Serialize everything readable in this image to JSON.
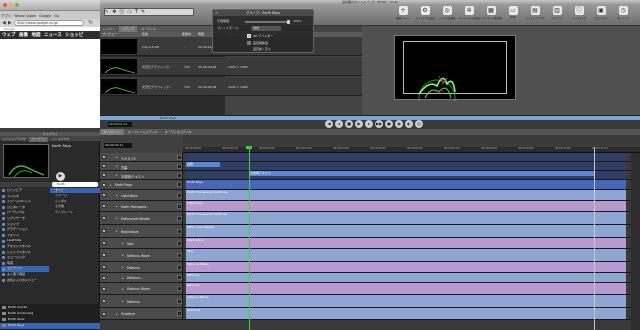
{
  "browser": {
    "tabs": [
      "アプリ",
      "Yahoo! Japan",
      "Google",
      "Go"
    ],
    "url": "http://www.google.co.jp/",
    "small_text": "Google",
    "nav": [
      "ウェブ",
      "画像",
      "地図",
      "ニュース",
      "ショッピ"
    ]
  },
  "fcp": {
    "title": "最初期のタイトルバック（NTSC）.motn",
    "toolbar": [
      {
        "label": "新規レイヤー",
        "icon": "+"
      },
      {
        "label": "ビヘイビアを追加",
        "icon": "⚙"
      },
      {
        "label": "フィルタを適用",
        "icon": "◎"
      },
      {
        "label": "パーティクルを作成",
        "icon": "✲"
      },
      {
        "label": "リプリケータを作成",
        "icon": "▦"
      },
      {
        "label": "HUD",
        "icon": "▭"
      },
      {
        "label": "ファイルブラウザ",
        "icon": "▤"
      },
      {
        "label": "ライブラリ",
        "icon": "▥"
      },
      {
        "label": "インスペクタ",
        "icon": "ⓘ"
      },
      {
        "label": "プロジェクト",
        "icon": "▣"
      },
      {
        "label": "タイミング",
        "icon": "◷"
      }
    ],
    "panel_tabs": [
      "レイヤー",
      "メディア",
      "オーディオ"
    ],
    "panel_columns": [
      "プレビュー",
      "名前",
      "使用中",
      "時間",
      "フレームサイズ",
      "アスペクト"
    ],
    "clips": [
      {
        "name": "Clip 4-5.aiff",
        "time": "00:00:02;11",
        "size": "",
        "flag": "-"
      },
      {
        "name": "光沢元グラフィック…",
        "time": "00:00:09;28",
        "size": "1920 × 1080",
        "flag": "YUV"
      },
      {
        "name": "光沢元グラフィック…",
        "time": "00:00:09;28",
        "size": "1920 × 1080",
        "flag": "YUV"
      }
    ],
    "hud": {
      "title": "グループ：Earth Rays",
      "opacity_label": "不透明度：",
      "opacity_value": "100%",
      "blend_label": "ブレンドモード：",
      "blend_value": "通常",
      "threed_label": "3D デバイダー",
      "scale_label": "固定解像度",
      "wh_label": "固定幅 / 高さ"
    },
    "strip": {
      "label": "Earth Rays",
      "timecode": "00:00:01;11"
    },
    "transport": [
      "◀",
      "◂",
      "■",
      "▶",
      "▸",
      "▶▶",
      "●",
      "◉",
      "◐",
      "◎"
    ],
    "timeline": {
      "tabs": [
        "タイムライン",
        "キーフレームエディタ",
        "オーディオエディタ"
      ],
      "timecode": "00:00:01;11",
      "ruler_ticks": [
        "00:00:00;00",
        "00:00:01;00",
        "00:00:02;00",
        "00:00:03;00",
        "00:00:04;00",
        "00:00:05;00",
        "00:00:06;00",
        "00:00:07;00",
        "00:00:08;00",
        "00:00:09;00",
        "00:00:10;00",
        "00:00:11;00"
      ],
      "layers": [
        {
          "name": "テキストE",
          "indent": 1,
          "bar": "",
          "bar_color": "#2f3e62"
        },
        {
          "name": "白幕",
          "indent": 1,
          "bar": "",
          "bar_color": "#2f3e62"
        },
        {
          "name": "半透明/テキスト",
          "indent": 1,
          "bar": "",
          "bar_color": "#2f3e62"
        },
        {
          "name": "Earth Rays",
          "indent": 0,
          "bar": "Earth Rays",
          "bar_color": "#4a66b8"
        },
        {
          "name": "Light Rays",
          "indent": 1,
          "bar": "Earth Transparent Outlines",
          "bar_color": "#8ea6d2"
        },
        {
          "name": "Earth Transpare…",
          "indent": 1,
          "bar": "Light Rays",
          "bar_color": "#b69ad0"
        },
        {
          "name": "Defocused Wealth",
          "indent": 1,
          "bar": "Earth Transparent Outlines",
          "bar_color": "#8ea6d2"
        },
        {
          "name": "Replicators",
          "indent": 1,
          "bar": "Defocused Wealth",
          "bar_color": "#8ea6d2"
        },
        {
          "name": "Spin",
          "indent": 2,
          "bar": "Replicators",
          "bar_color": "#b69ad0"
        },
        {
          "name": "Defocus Wave",
          "indent": 2,
          "bar": "Spin",
          "bar_color": "#8ea6d2"
        },
        {
          "name": "Defocus",
          "indent": 2,
          "bar": "Defocus Wave",
          "bar_color": "#b69ad0"
        },
        {
          "name": "Defocus…",
          "indent": 2,
          "bar": "Defocus",
          "bar_color": "#8ea6d2"
        },
        {
          "name": "Defocus Wave",
          "indent": 2,
          "bar": "Defocus",
          "bar_color": "#b69ad0"
        },
        {
          "name": "Defocus",
          "indent": 2,
          "bar": "Defocus Wave",
          "bar_color": "#8ea6d2"
        },
        {
          "name": "Gradient",
          "indent": 1,
          "bar": "Gradient",
          "bar_color": "#8ea6d2"
        }
      ],
      "upper_clips": [
        {
          "label": "白幕",
          "color": "#5a86d6"
        },
        {
          "label": "半透明テキスト",
          "color": "#5a86d6"
        }
      ]
    }
  },
  "library": {
    "title": "ライブラリ",
    "tabs": [
      "ファイルブラウザ",
      "ライブラリ",
      "インスペクタ"
    ],
    "preview_title": "Earth Rays",
    "search": "Earth",
    "categories": [
      "ビヘイビア",
      "フィルタ",
      "イメージユニット",
      "ジェネレータ",
      "パーティクル",
      "リプリケータ",
      "シェイプ",
      "グラデーション",
      "フォント",
      "LiveFonts",
      "テキストスタイル",
      "シェイプスタイル",
      "ミュージック",
      "写真",
      "コンテンツ",
      "よく使う項目",
      "お気に入りのメニュー"
    ],
    "subs": [
      "すべて",
      "イメージ",
      "シンボル",
      "その他",
      "テンプレート"
    ],
    "bottom": [
      "Earth Cracks",
      "Earth Continuing",
      "Earth Glow",
      "Earth Rays"
    ],
    "selected_category": "コンテンツ"
  }
}
